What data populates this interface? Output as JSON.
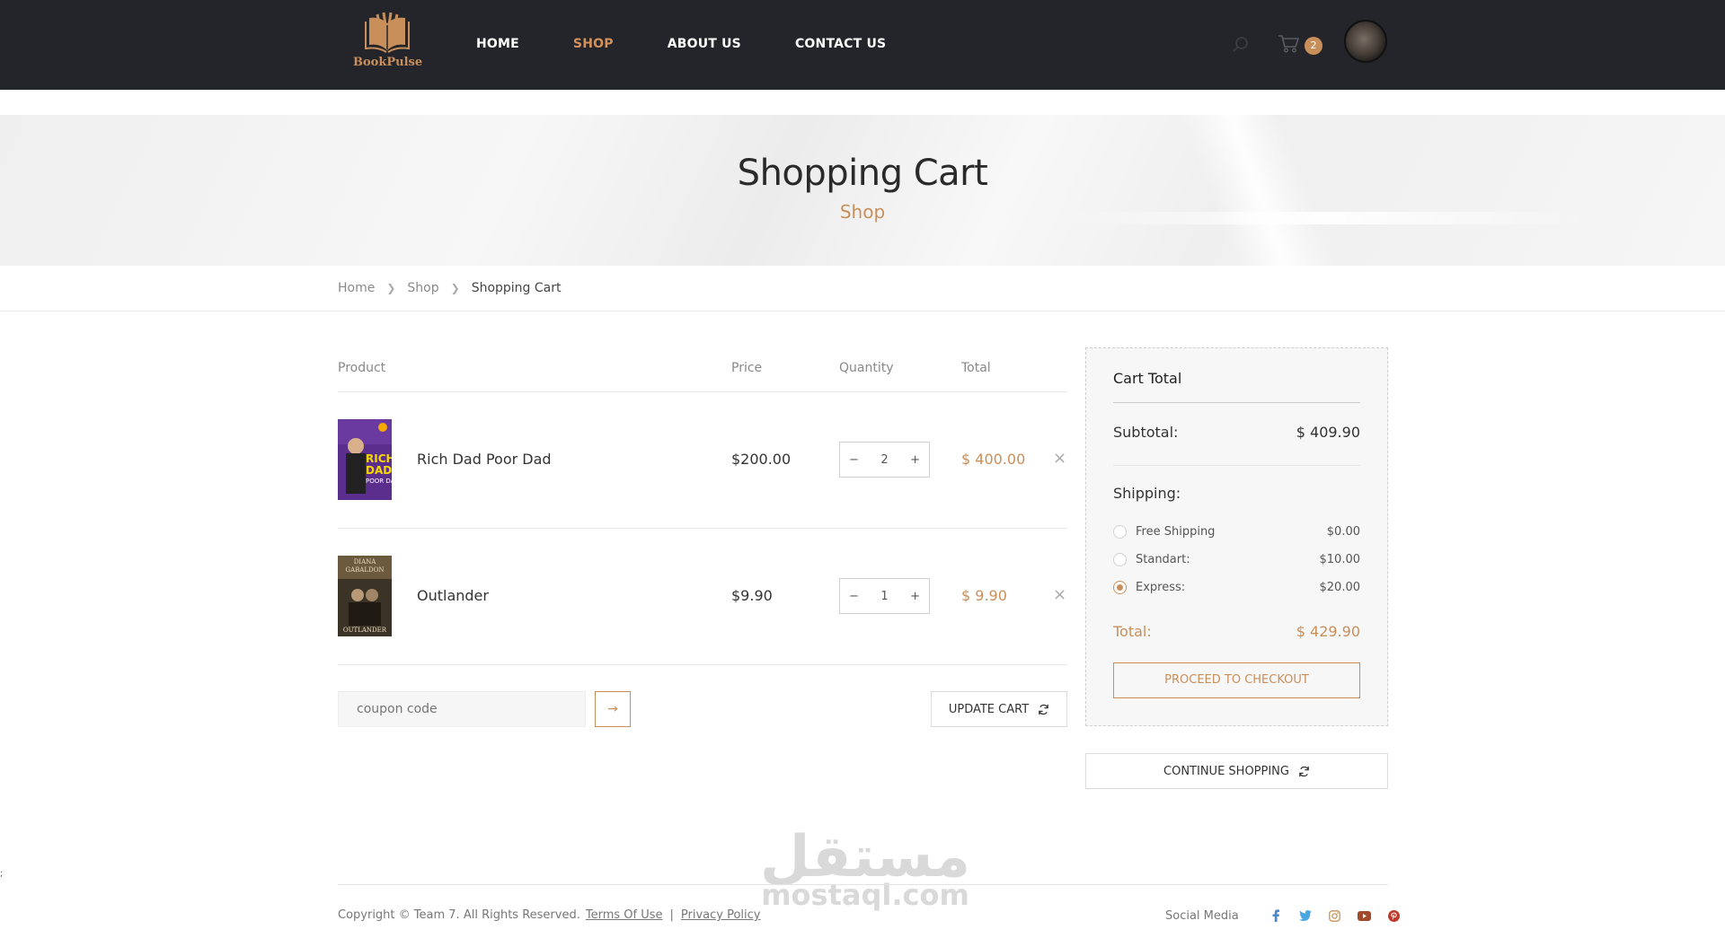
{
  "brand": {
    "name": "BookPulse",
    "accent": "#c98f5a",
    "header_bg": "#23252b"
  },
  "nav": [
    {
      "label": "HOME",
      "active": false
    },
    {
      "label": "SHOP",
      "active": true
    },
    {
      "label": "ABOUT US",
      "active": false
    },
    {
      "label": "CONTACT US",
      "active": false
    }
  ],
  "header": {
    "cart_count": "2",
    "icons": [
      "search-icon",
      "cart-icon",
      "avatar"
    ]
  },
  "hero": {
    "title": "Shopping Cart",
    "subtitle": "Shop"
  },
  "breadcrumb": [
    "Home",
    "Shop",
    "Shopping Cart"
  ],
  "table": {
    "headers": {
      "product": "Product",
      "price": "Price",
      "quantity": "Quantity",
      "total": "Total"
    },
    "rows": [
      {
        "name": "Rich Dad Poor Dad",
        "price": "$200.00",
        "qty": "2",
        "total": "$ 400.00",
        "cover": "rich-dad-poor-dad-cover"
      },
      {
        "name": "Outlander",
        "price": "$9.90",
        "qty": "1",
        "total": "$ 9.90",
        "cover": "outlander-cover"
      }
    ],
    "qty_minus": "−",
    "qty_plus": "+",
    "remove": "×"
  },
  "coupon": {
    "placeholder": "coupon code",
    "submit": "→"
  },
  "update_cart": "UPDATE CART",
  "cart_total": {
    "title": "Cart Total",
    "subtotal_label": "Subtotal:",
    "subtotal_value": "$ 409.90",
    "shipping_label": "Shipping:",
    "options": [
      {
        "label": "Free Shipping",
        "price": "$0.00",
        "selected": false
      },
      {
        "label": "Standart:",
        "price": "$10.00",
        "selected": false
      },
      {
        "label": "Express:",
        "price": "$20.00",
        "selected": true
      }
    ],
    "total_label": "Total:",
    "total_value": "$ 429.90",
    "checkout": "PROCEED TO CHECKOUT"
  },
  "continue_shopping": "CONTINUE SHOPPING",
  "watermark": {
    "arabic": "مستقل",
    "latin": "mostaql.com"
  },
  "footer": {
    "copyright": "Copyright © Team 7. All Rights Reserved.",
    "terms": "Terms Of Use",
    "separator": "|",
    "privacy": "Privacy Policy",
    "social_label": "Social Media",
    "social_icons": [
      "facebook-icon",
      "twitter-icon",
      "instagram-icon",
      "youtube-icon",
      "pinterest-icon"
    ]
  },
  "stray_mark": ";"
}
